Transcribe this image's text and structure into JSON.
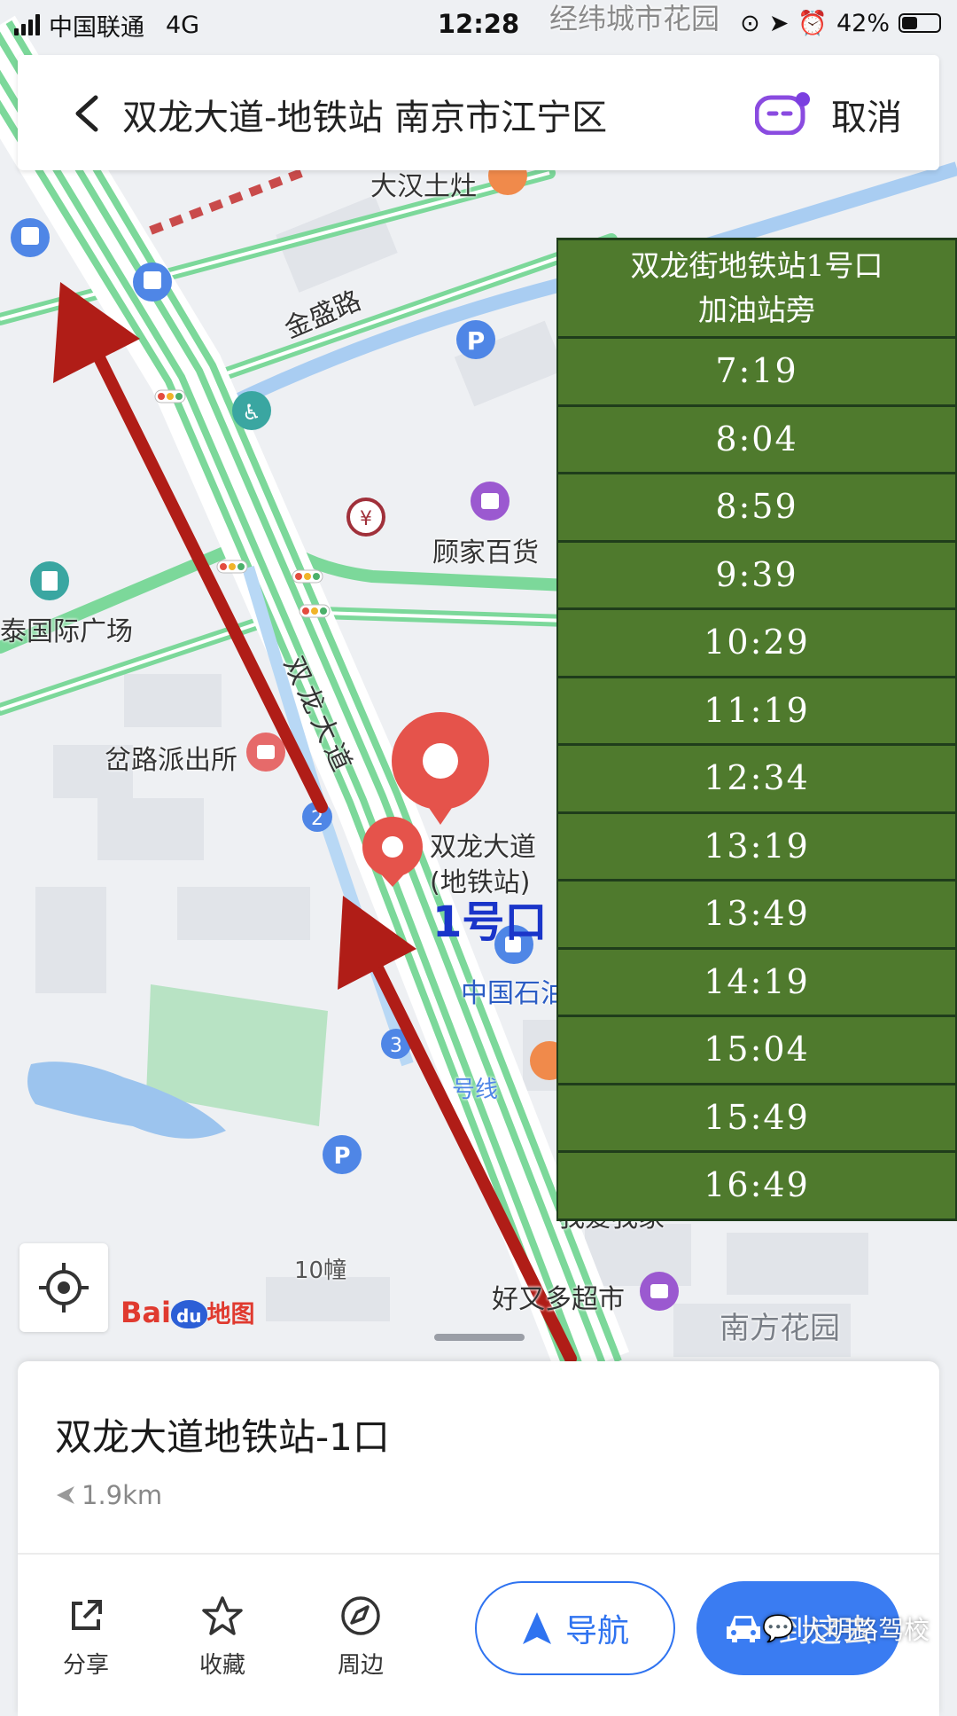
{
  "status_bar": {
    "carrier": "中国联通",
    "network": "4G",
    "time": "12:28",
    "battery": "42%",
    "battery_level": 0.42
  },
  "search": {
    "query": "双龙大道-地铁站 南京市江宁区",
    "cancel": "取消"
  },
  "map_labels": {
    "top_partial": "经纬城市花园",
    "restaurant": "大汉土灶",
    "road_jinsheng": "金盛路",
    "store": "顾家百货",
    "plaza": "泰国际广场",
    "police": "岔路派出所",
    "road_shuanglong": "双龙大道",
    "pin_name_1": "双龙大道",
    "pin_name_2": "(地铁站)",
    "exit_label": "1号口",
    "gas_station": "中国石油",
    "metro_line": "号线",
    "home": "我爱我家",
    "building": "10幢",
    "supermarket": "好又多超市",
    "garden": "南方花园",
    "exit_2": "2",
    "exit_3": "3"
  },
  "schedule": {
    "header_line1": "双龙街地铁站1号口",
    "header_line2": "加油站旁",
    "times": [
      "7:19",
      "8:04",
      "8:59",
      "9:39",
      "10:29",
      "11:19",
      "12:34",
      "13:19",
      "13:49",
      "14:19",
      "15:04",
      "15:49",
      "16:49"
    ]
  },
  "baidu": {
    "bai": "Bai",
    "du": "du",
    "map": "地图"
  },
  "place": {
    "title": "双龙大道地铁站-1口",
    "distance": "1.9km"
  },
  "actions": {
    "share": "分享",
    "favorite": "收藏",
    "nearby": "周边",
    "navigate": "导航",
    "go_here": "到这去"
  },
  "watermark": "大明路驾校",
  "colors": {
    "schedule_bg": "#4f7a2d",
    "primary_blue": "#3a7cf2",
    "route_green": "#6fd08a",
    "arrow_red": "#b01d17",
    "pin_red": "#e5534b"
  }
}
